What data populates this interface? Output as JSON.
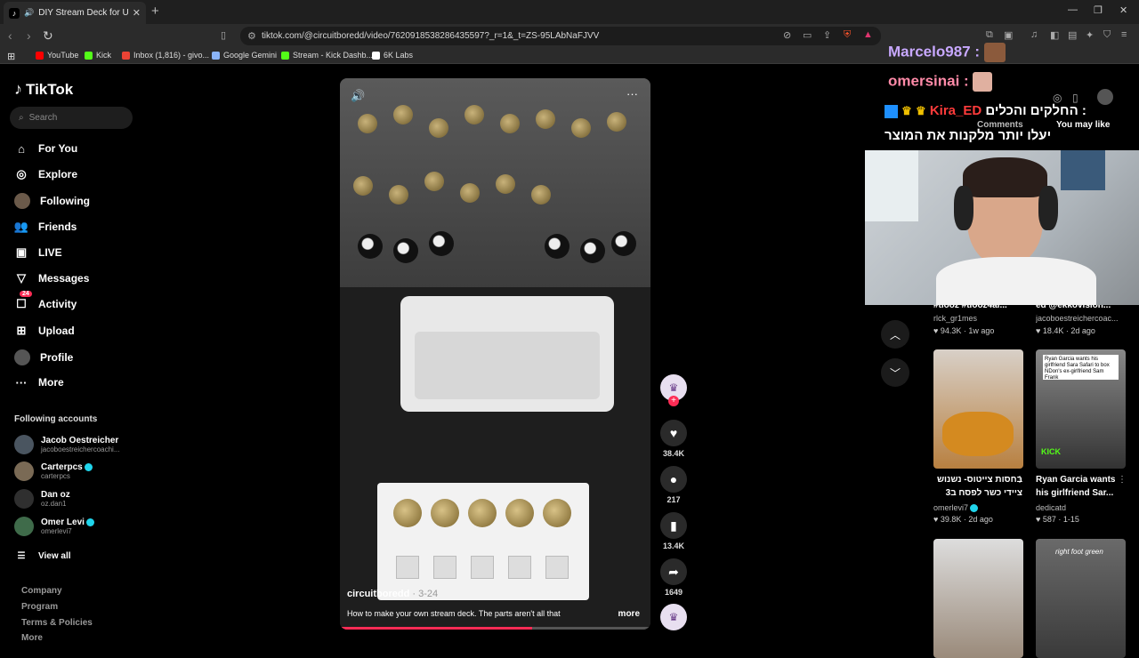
{
  "browser": {
    "tab_title": "DIY Stream Deck for Under $...",
    "url": "tiktok.com/@circuitboredd/video/7620918538286435597?_r=1&_t=ZS-95LAbNaFJVV",
    "bookmarks": [
      "YouTube",
      "Kick",
      "Inbox (1,816) - givo...",
      "Google Gemini",
      "Stream - Kick Dashb...",
      "6K Labs"
    ]
  },
  "sidebar": {
    "logo": "TikTok",
    "search_placeholder": "Search",
    "nav": [
      "For You",
      "Explore",
      "Following",
      "Friends",
      "LIVE",
      "Messages",
      "Activity",
      "Upload",
      "Profile",
      "More"
    ],
    "activity_badge": "24",
    "following_header": "Following accounts",
    "accounts": [
      {
        "name": "Jacob Oestreicher",
        "handle": "jacoboestreichercoachi..."
      },
      {
        "name": "Carterpcs",
        "handle": "carterpcs"
      },
      {
        "name": "Dan oz",
        "handle": "oz.dan1"
      },
      {
        "name": "Omer Levi",
        "handle": "omerlevi7"
      }
    ],
    "view_all": "View all",
    "footer": [
      "Company",
      "Program",
      "Terms & Policies",
      "More"
    ]
  },
  "video": {
    "author": "circuitboredd",
    "date": "· 3-24",
    "description": "How to make your own stream deck. The parts aren't all that",
    "more": "more",
    "progress": 0.62
  },
  "actions": {
    "likes": "38.4K",
    "comments": "217",
    "saves": "13.4K",
    "shares": "1649"
  },
  "overlay": {
    "chat1": "Marcelo987 :",
    "chat2": "omersinai :",
    "chat3_name": "Kira_ED",
    "chat3_text": "החלקים והכלים :",
    "chat4": "יעלו יותר מלקנות את המוצר",
    "tabs": [
      "Comments",
      "You may like"
    ]
  },
  "feed": [
    {
      "caption": "#tiooz #tiooz4ai...",
      "user": "rlck_gr1mes",
      "likes": "94.3K",
      "age": "1w ago"
    },
    {
      "caption": "ed @ekkovision...",
      "user": "jacoboestreichercoac...",
      "likes": "18.4K",
      "age": "2d ago"
    },
    {
      "caption": "בחסות צייטוס- נשנוש",
      "caption2": "ציידי כשר לפסח ב3",
      "user": "omerlevi7",
      "likes": "39.8K",
      "age": "2d ago"
    },
    {
      "caption": "Ryan Garcia wants",
      "caption2": "his girlfriend Sar...",
      "user": "dedicatd",
      "likes": "587",
      "age": "1-15"
    },
    {
      "caption": "",
      "user": "",
      "likes": "",
      "age": ""
    },
    {
      "caption": "right foot green",
      "user": "",
      "likes": "",
      "age": ""
    }
  ],
  "thumb_texts": {
    "ryan": "Ryan Garcia wants his girlfriend Sara Safari to box NDon's ex-girlfriend Sam Frank",
    "kick": "KICK"
  }
}
